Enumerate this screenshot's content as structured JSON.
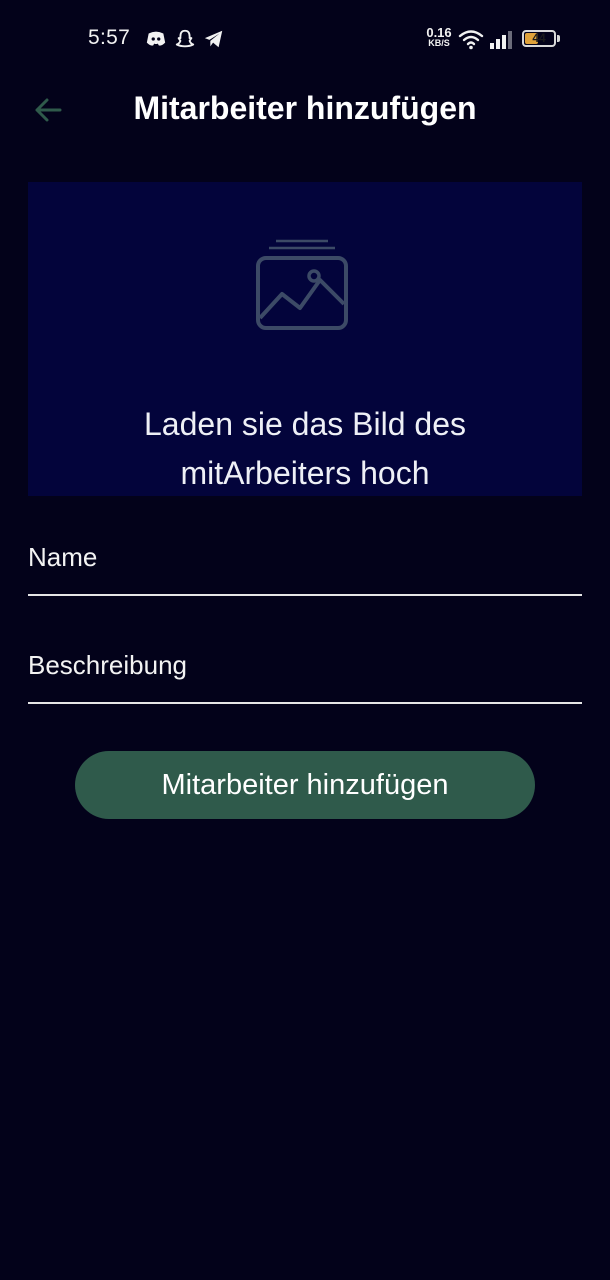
{
  "status_bar": {
    "time": "5:57",
    "net_speed_value": "0.16",
    "net_speed_unit": "KB/S",
    "battery_level": "44",
    "battery_fraction": 0.44,
    "icons": [
      "discord-icon",
      "snapchat-icon",
      "telegram-icon",
      "wifi-icon",
      "signal-icon",
      "battery-icon"
    ]
  },
  "app_bar": {
    "back_icon": "arrow-left-icon",
    "title": "Mitarbeiter hinzufügen"
  },
  "upload": {
    "icon": "image-placeholder-icon",
    "text": "Laden sie das Bild des mitArbeiters hoch"
  },
  "form": {
    "name_label": "Name",
    "description_label": "Beschreibung"
  },
  "submit": {
    "label": "Mitarbeiter hinzufügen"
  },
  "colors": {
    "background": "#03021a",
    "upload_background": "#03043b",
    "accent": "#2f5a4b",
    "back_arrow": "#2f5a4b",
    "icon_muted": "#3c4a66"
  }
}
